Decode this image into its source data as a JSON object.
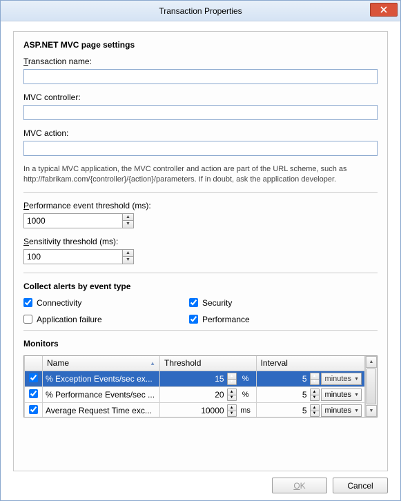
{
  "window": {
    "title": "Transaction Properties"
  },
  "section": {
    "page_settings": "ASP.NET MVC page settings",
    "collect_alerts": "Collect alerts by event type",
    "monitors": "Monitors"
  },
  "labels": {
    "transaction_name_pre": "T",
    "transaction_name_post": "ransaction name:",
    "mvc_controller": "MVC controller:",
    "mvc_action": "MVC action:",
    "help": "In a typical MVC application, the MVC controller and action are part of the URL scheme, such as http://fabrikam.com/{controller}/{action}/parameters. If in doubt, ask the application developer.",
    "perf_threshold_pre": "P",
    "perf_threshold_post": "erformance event threshold (ms):",
    "sens_threshold_pre": "S",
    "sens_threshold_post": "ensitivity threshold (ms):"
  },
  "values": {
    "transaction_name": "",
    "mvc_controller": "",
    "mvc_action": "",
    "perf_threshold": "1000",
    "sens_threshold": "100"
  },
  "alerts": {
    "connectivity": {
      "label": "Connectivity",
      "checked": true
    },
    "security": {
      "label": "Security",
      "checked": true
    },
    "app_failure": {
      "label": "Application failure",
      "checked": false
    },
    "performance": {
      "label": "Performance",
      "checked": true
    }
  },
  "monitors": {
    "headers": {
      "chk": "",
      "name": "Name",
      "threshold": "Threshold",
      "interval": "Interval"
    },
    "rows": [
      {
        "checked": true,
        "name": "% Exception Events/sec ex...",
        "threshold": "15",
        "unit": "%",
        "interval": "5",
        "interval_unit": "minutes",
        "selected": true
      },
      {
        "checked": true,
        "name": "% Performance Events/sec ...",
        "threshold": "20",
        "unit": "%",
        "interval": "5",
        "interval_unit": "minutes",
        "selected": false
      },
      {
        "checked": true,
        "name": "Average Request Time exc...",
        "threshold": "10000",
        "unit": "ms",
        "interval": "5",
        "interval_unit": "minutes",
        "selected": false
      }
    ]
  },
  "buttons": {
    "ok_pre": "O",
    "ok_post": "K",
    "cancel": "Cancel"
  }
}
